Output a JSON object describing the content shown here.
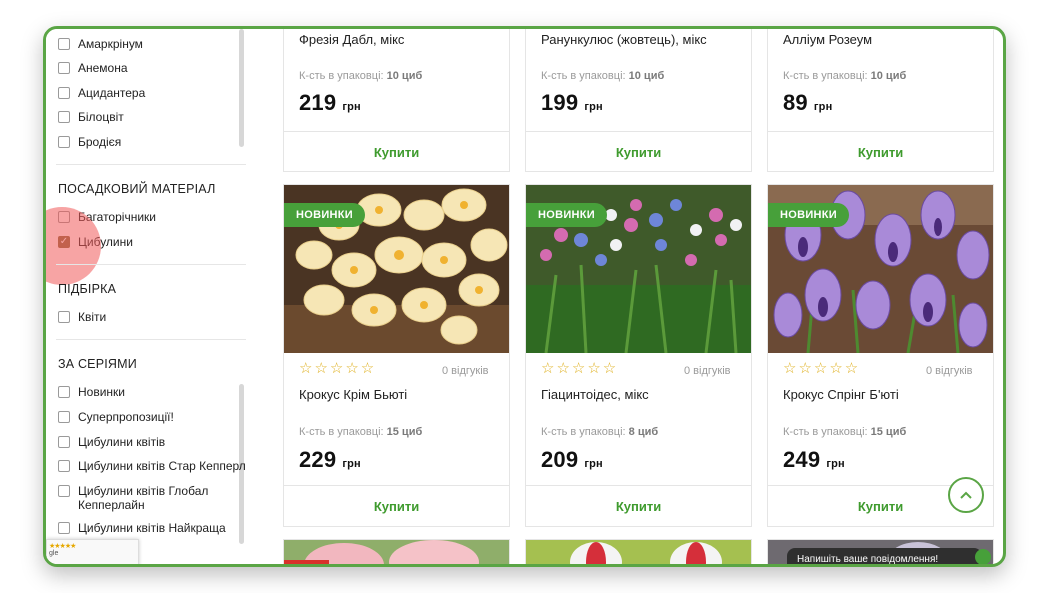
{
  "filters": {
    "flower_types": [
      "Амаркрінум",
      "Анемона",
      "Ацидантера",
      "Білоцвіт",
      "Бродієя"
    ],
    "planting_title": "ПОСАДКОВИЙ МАТЕРІАЛ",
    "planting": [
      {
        "label": "Багаторічники",
        "checked": false
      },
      {
        "label": "Цибулини",
        "checked": true
      }
    ],
    "selection_title": "ПІДБІРКА",
    "selection": [
      "Квіти"
    ],
    "series_title": "ЗА СЕРІЯМИ",
    "series": [
      "Новинки",
      "Суперпропозиції!",
      "Цибулини квітів",
      "Цибулини квітів Стар Кепперл",
      "Цибулини квітів Глобал Кепперлайн",
      "Цибулини квітів Найкраща"
    ]
  },
  "recaptcha": {
    "stars": "★★★★★",
    "text": "gle"
  },
  "products_top": [
    {
      "name": "Фрезія Дабл, мікс",
      "qty_label": "К-сть в упаковці:",
      "qty": "10 циб",
      "price": "219",
      "currency": "грн",
      "buy": "Купити"
    },
    {
      "name": "Ранункулюс (жовтець), мікс",
      "qty_label": "К-сть в упаковці:",
      "qty": "10 циб",
      "price": "199",
      "currency": "грн",
      "buy": "Купити"
    },
    {
      "name": "Алліум Розеум",
      "qty_label": "К-сть в упаковці:",
      "qty": "10 циб",
      "price": "89",
      "currency": "грн",
      "buy": "Купити"
    }
  ],
  "products_mid": [
    {
      "badge": "НОВИНКИ",
      "stars": "☆☆☆☆☆",
      "reviews": "0 відгуків",
      "name": "Крокус Крім Бьюті",
      "qty_label": "К-сть в упаковці:",
      "qty": "15 циб",
      "price": "229",
      "currency": "грн",
      "buy": "Купити"
    },
    {
      "badge": "НОВИНКИ",
      "stars": "☆☆☆☆☆",
      "reviews": "0 відгуків",
      "name": "Гіацинтоідес, мікс",
      "qty_label": "К-сть в упаковці:",
      "qty": "8 циб",
      "price": "209",
      "currency": "грн",
      "buy": "Купити"
    },
    {
      "badge": "НОВИНКИ",
      "stars": "☆☆☆☆☆",
      "reviews": "0 відгуків",
      "name": "Крокус Спрінг Б'юті",
      "qty_label": "К-сть в упаковці:",
      "qty": "15 циб",
      "price": "249",
      "currency": "грн",
      "buy": "Купити"
    }
  ],
  "chat": {
    "text": "Напишіть ваше повідомлення!"
  },
  "colors": {
    "accent": "#47a03a",
    "frame": "#5aa545",
    "checked": "#8b6a3e"
  }
}
